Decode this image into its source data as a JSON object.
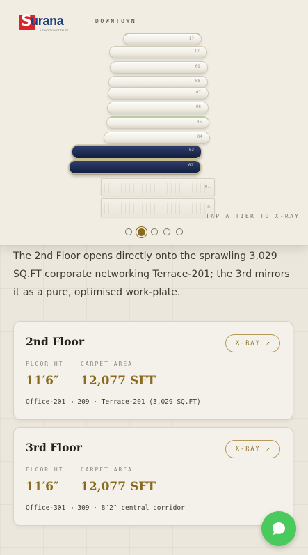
{
  "brand": {
    "logo_word": "urana",
    "logo_letter": "S",
    "logo_tagline": "A TRADITION OF TRUST",
    "location": "DOWNTOWN",
    "brand_color": "#d9262b",
    "brand_blue": "#1d3f80"
  },
  "stack": {
    "tiers": [
      {
        "num": "1?",
        "state": "default"
      },
      {
        "num": "1?",
        "state": "default"
      },
      {
        "num": "09",
        "state": "default"
      },
      {
        "num": "08",
        "state": "default"
      },
      {
        "num": "07",
        "state": "default"
      },
      {
        "num": "06",
        "state": "default"
      },
      {
        "num": "05",
        "state": "default"
      },
      {
        "num": "04",
        "state": "default"
      },
      {
        "num": "03",
        "state": "active"
      },
      {
        "num": "02",
        "state": "active"
      },
      {
        "num": "01",
        "state": "base"
      },
      {
        "num": "G",
        "state": "base"
      }
    ],
    "hint": "TAP A TIER TO X-RAY",
    "active_color": "#1d2a52"
  },
  "carousel": {
    "count": 5,
    "active_index": 1
  },
  "intro": "The 2nd Floor opens directly onto the sprawling 3,029 SQ.FT corporate networking Terrace-201; the 3rd mirrors it as a pure, optimised work-plate.",
  "floors": [
    {
      "title": "2nd Floor",
      "xray_label": "X-RAY",
      "floor_ht_label": "FLOOR HT",
      "floor_ht": "11′6″",
      "carpet_label": "CARPET AREA",
      "carpet_area": "12,077 SFT",
      "detail": "Office-201 → 209 · Terrace-201 (3,029 SQ.FT)"
    },
    {
      "title": "3rd Floor",
      "xray_label": "X-RAY",
      "floor_ht_label": "FLOOR HT",
      "floor_ht": "11′6″",
      "carpet_label": "CARPET AREA",
      "carpet_area": "12,077 SFT",
      "detail": "Office-301 → 309 · 8′2″ central corridor"
    }
  ],
  "accent_color": "#8a6a1f",
  "chat": {
    "icon": "chat-bubble-icon",
    "color": "#4ac95d"
  }
}
